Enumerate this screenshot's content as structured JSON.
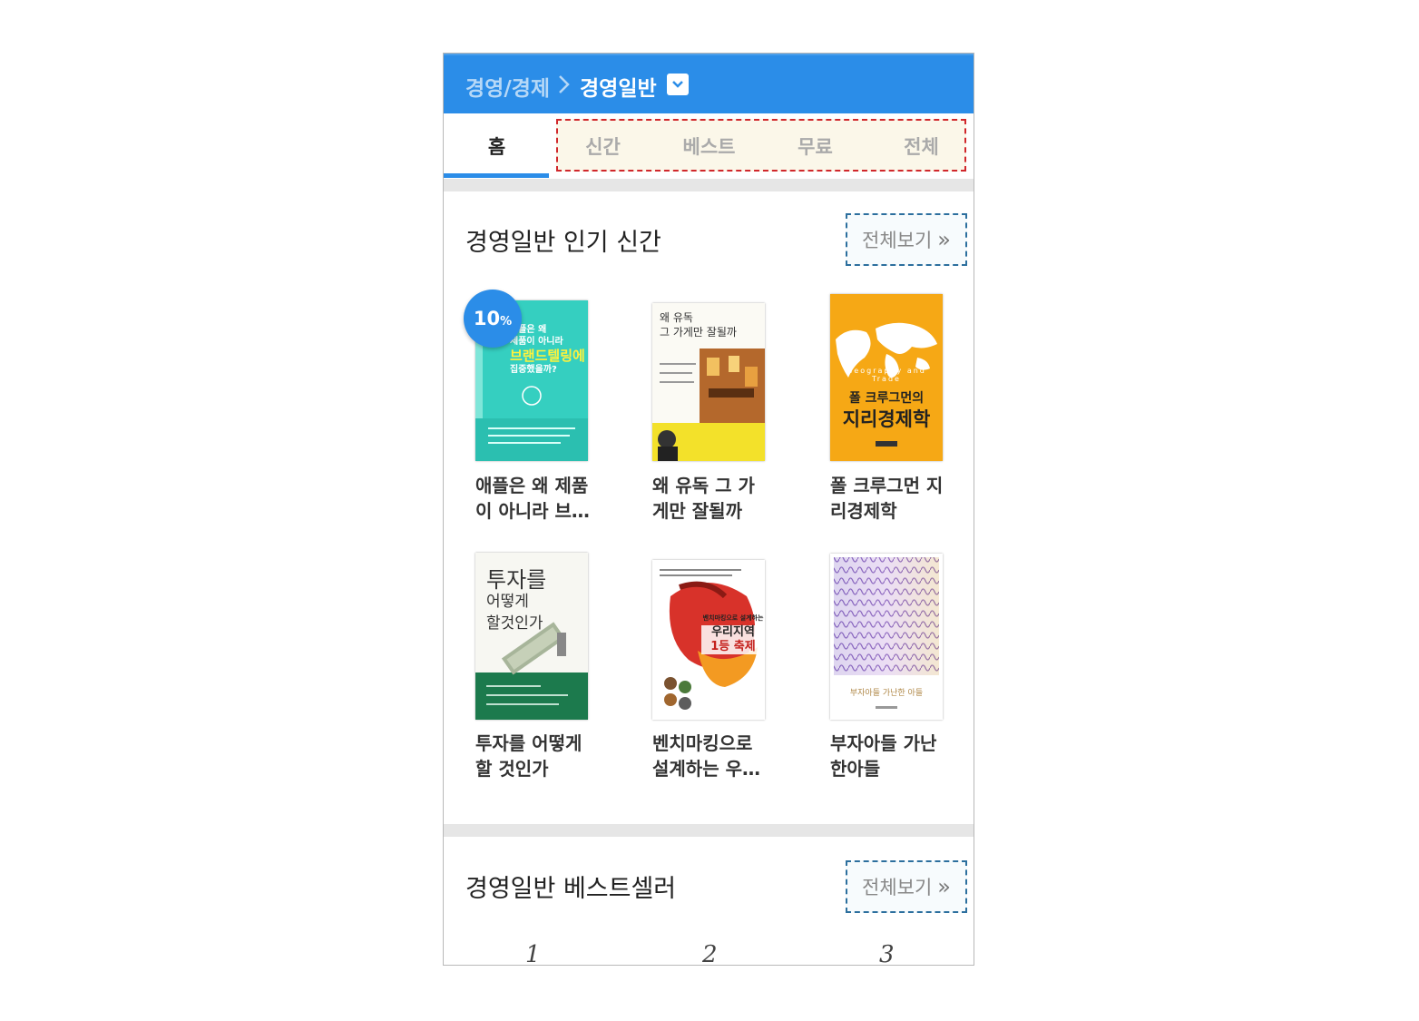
{
  "header": {
    "parent_category": "경영/경제",
    "current_category": "경영일반"
  },
  "tabs": [
    {
      "label": "홈",
      "active": true
    },
    {
      "label": "신간",
      "active": false
    },
    {
      "label": "베스트",
      "active": false
    },
    {
      "label": "무료",
      "active": false
    },
    {
      "label": "전체",
      "active": false
    }
  ],
  "new_books": {
    "title": "경영일반 인기 신간",
    "more_label": "전체보기",
    "items": [
      {
        "title_line1": "애플은 왜 제품",
        "title_line2": "이 아니라 브…",
        "badge": "10",
        "badge_unit": "%"
      },
      {
        "title_line1": "왜 유독 그 가",
        "title_line2": "게만 잘될까"
      },
      {
        "title_line1": "폴 크루그먼 지",
        "title_line2": "리경제학"
      },
      {
        "title_line1": "투자를 어떻게",
        "title_line2": "할 것인가"
      },
      {
        "title_line1": "벤치마킹으로",
        "title_line2": "설계하는 우…"
      },
      {
        "title_line1": "부자아들 가난",
        "title_line2": "한아들"
      }
    ]
  },
  "covers": {
    "apple": {
      "line1": "애플은 왜",
      "line2": "제품이 아니라",
      "line3": "브랜드텔링에",
      "line4": "집중했을까?"
    },
    "yudok": {
      "line1": "왜 유독",
      "line2": "그 가게만 잘될까"
    },
    "krugman": {
      "line1": "폴 크루그먼의",
      "line2": "지리경제학",
      "sub": "Geography and Trade"
    },
    "invest": {
      "line1": "투자를",
      "line2": "어떻게",
      "line3": "할것인가"
    },
    "bench": {
      "line1": "벤치마킹으로 설계하는",
      "line2": "우리지역",
      "line3": "1등 축제"
    },
    "rich": {
      "line1": "부자아들 가난한 아들"
    }
  },
  "bestseller": {
    "title": "경영일반 베스트셀러",
    "more_label": "전체보기",
    "ranks": [
      "1",
      "2",
      "3"
    ]
  },
  "colors": {
    "accent": "#2b8de8",
    "highlight_border": "#d0272b",
    "more_border": "#2c6f9e"
  }
}
